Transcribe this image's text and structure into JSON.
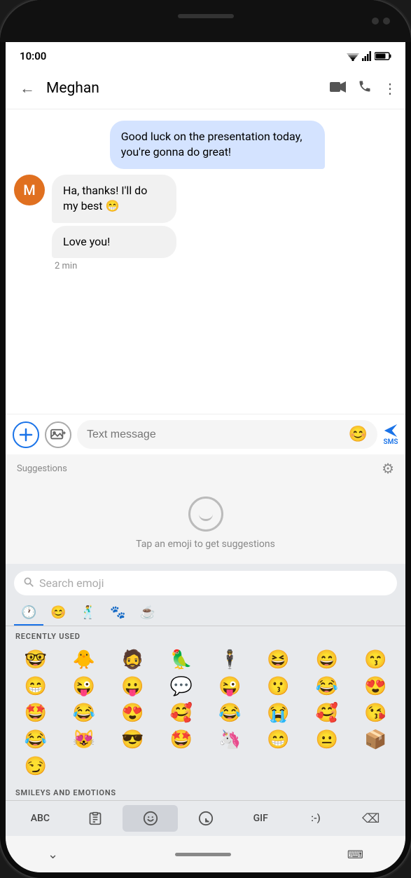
{
  "status_bar": {
    "time": "10:00",
    "wifi": "▲",
    "signal": "▲",
    "battery": "▮"
  },
  "app_bar": {
    "back_label": "←",
    "contact_name": "Meghan",
    "video_icon": "📹",
    "phone_icon": "📞",
    "more_icon": "⋮"
  },
  "messages": [
    {
      "type": "sent",
      "text": "Good luck on the presentation today, you're gonna do great!"
    },
    {
      "type": "received",
      "avatar_letter": "M",
      "bubbles": [
        "Ha, thanks! I'll do my best 😁",
        "Love you!"
      ],
      "time": "2 min"
    }
  ],
  "input_area": {
    "plus_icon": "+",
    "image_icon": "🖼",
    "placeholder": "Text message",
    "emoji_icon": "😊",
    "send_label": "SMS"
  },
  "suggestions": {
    "label": "Suggestions",
    "gear_icon": "⚙",
    "tap_text": "Tap an emoji to get suggestions"
  },
  "emoji_keyboard": {
    "search_placeholder": "Search emoji",
    "category_tabs": [
      {
        "icon": "🕐",
        "active": true
      },
      {
        "icon": "😊",
        "active": false
      },
      {
        "icon": "🕺",
        "active": false
      },
      {
        "icon": "🐾",
        "active": false
      },
      {
        "icon": "☕",
        "active": false
      }
    ],
    "recently_used_label": "RECENTLY USED",
    "recently_used": [
      "🤓",
      "🐥",
      "🧔",
      "🦜",
      "🕴",
      "😆",
      "😄",
      "😙",
      "😁",
      "😜",
      "😛",
      "💬",
      "😜",
      "😗",
      "😂",
      "😍",
      "🤩",
      "😂",
      "😍",
      "🥰",
      "😂",
      "😭",
      "🥰",
      "😘",
      "😂",
      "😻",
      "😎",
      "🤩",
      "🦄",
      "😁",
      "😐",
      "📦",
      "😏"
    ],
    "smileys_label": "SMILEYS AND EMOTIONS",
    "toolbar": {
      "abc_label": "ABC",
      "clipboard_icon": "📋",
      "emoji_icon": "😊",
      "sticker_icon": "🎭",
      "gif_label": "GIF",
      "text_face": ":-)",
      "backspace_icon": "⌫"
    }
  },
  "nav_bar": {
    "chevron": "⌄",
    "keyboard_icon": "⌨"
  }
}
